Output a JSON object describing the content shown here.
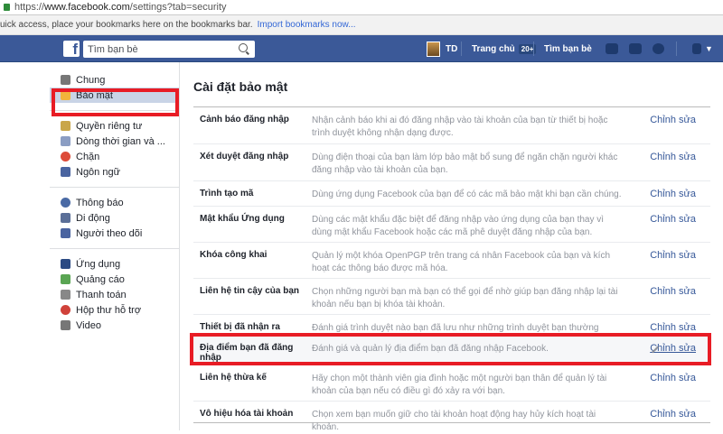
{
  "browser": {
    "url_prefix": "https://",
    "url_domain": "www.facebook.com",
    "url_path": "/settings?tab=security",
    "bookmarks_text": "uick access, place your bookmarks here on the bookmarks bar.",
    "bookmarks_link": "Import bookmarks now..."
  },
  "header": {
    "search_placeholder": "Tìm bạn bè",
    "user": "TD",
    "home": "Trang chủ",
    "home_badge": "20+",
    "find_friends": "Tìm bạn bè"
  },
  "sidebar": {
    "groups": [
      [
        {
          "label": "Chung",
          "icon": "gear-icon",
          "color": "#777"
        },
        {
          "label": "Bảo mật",
          "icon": "shield-icon",
          "color": "#f2b53b",
          "active": true
        }
      ],
      [
        {
          "label": "Quyền riêng tư",
          "icon": "lock-icon",
          "color": "#c9a64a"
        },
        {
          "label": "Dòng thời gian và ...",
          "icon": "timeline-icon",
          "color": "#8b9dc3"
        },
        {
          "label": "Chặn",
          "icon": "block-icon",
          "color": "#dd4b39"
        },
        {
          "label": "Ngôn ngữ",
          "icon": "language-icon",
          "color": "#4a64a0"
        }
      ],
      [
        {
          "label": "Thông báo",
          "icon": "globe-icon",
          "color": "#4a6aa5"
        },
        {
          "label": "Di động",
          "icon": "mobile-icon",
          "color": "#5b6f98"
        },
        {
          "label": "Người theo dõi",
          "icon": "rss-icon",
          "color": "#4a64a0"
        }
      ],
      [
        {
          "label": "Ứng dụng",
          "icon": "apps-icon",
          "color": "#2b4a83"
        },
        {
          "label": "Quảng cáo",
          "icon": "ads-icon",
          "color": "#5aa553"
        },
        {
          "label": "Thanh toán",
          "icon": "card-icon",
          "color": "#888"
        },
        {
          "label": "Hộp thư hỗ trợ",
          "icon": "lifebuoy-icon",
          "color": "#d0423a"
        },
        {
          "label": "Video",
          "icon": "film-icon",
          "color": "#777"
        }
      ]
    ]
  },
  "main": {
    "title": "Cài đặt bảo mật",
    "edit_label": "Chỉnh sửa",
    "rows": [
      {
        "label": "Cảnh báo đăng nhập",
        "desc": "Nhận cảnh báo khi ai đó đăng nhập vào tài khoản của bạn từ thiết bị hoặc trình duyệt không nhận dạng được."
      },
      {
        "label": "Xét duyệt đăng nhập",
        "desc": "Dùng điện thoại của bạn làm lớp bảo mật bổ sung để ngăn chặn người khác đăng nhập vào tài khoản của bạn."
      },
      {
        "label": "Trình tạo mã",
        "desc": "Dùng ứng dụng Facebook của bạn để có các mã bảo mật khi bạn cần chúng."
      },
      {
        "label": "Mật khẩu Ứng dụng",
        "desc": "Dùng các mật khẩu đặc biệt để đăng nhập vào ứng dụng của bạn thay vì dùng mật khẩu Facebook hoặc các mã phê duyệt đăng nhập của bạn."
      },
      {
        "label": "Khóa công khai",
        "desc": "Quản lý một khóa OpenPGP trên trang cá nhân Facebook của bạn và kích hoạt các thông báo được mã hóa."
      },
      {
        "label": "Liên hệ tin cậy của bạn",
        "desc": "Chọn những người bạn mà bạn có thể gọi để nhờ giúp bạn đăng nhập lại tài khoản nếu bạn bị khóa tài khoản."
      },
      {
        "label": "Thiết bị đã nhận ra",
        "desc": "Đánh giá trình duyệt nào bạn đã lưu như những trình duyệt bạn thường dùng."
      },
      {
        "label": "Địa điểm bạn đã đăng nhập",
        "desc": "Đánh giá và quản lý địa điểm bạn đã đăng nhập Facebook.",
        "highlighted": true
      },
      {
        "label": "Liên hệ thừa kế",
        "desc": "Hãy chọn một thành viên gia đình hoặc một người bạn thân để quản lý tài khoản của bạn nếu có điều gì đó xảy ra với bạn."
      },
      {
        "label": "Vô hiệu hóa tài khoản",
        "desc": "Chọn xem bạn muốn giữ cho tài khoản hoạt động hay hủy kích hoạt tài khoản."
      }
    ]
  }
}
